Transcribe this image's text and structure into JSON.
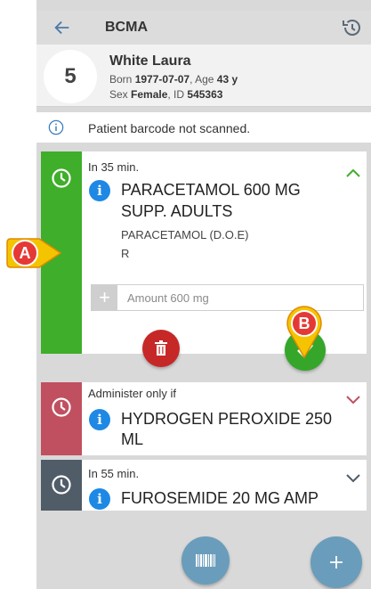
{
  "header": {
    "title": "BCMA"
  },
  "patient": {
    "bed": "5",
    "name": "White Laura",
    "born_label": "Born",
    "born_value": "1977-07-07",
    "age_label": ", Age",
    "age_value": "43 y",
    "sex_label": "Sex",
    "sex_value": "Female",
    "id_label": ", ID",
    "id_value": "545363"
  },
  "notice": {
    "text": "Patient barcode not scanned."
  },
  "cards": [
    {
      "time": "In 35 min.",
      "drug_line1": "PARACETAMOL 600 MG",
      "drug_line2": "SUPP. ADULTS",
      "generic": "PARACETAMOL (D.O.E)",
      "route": "R",
      "amount_placeholder": "Amount 600 mg",
      "strip_color": "#3fae2a"
    },
    {
      "time": "Administer only if",
      "drug_line1": "HYDROGEN PEROXIDE 250",
      "drug_line2": "ML",
      "strip_color": "#c05060"
    },
    {
      "time": "In 55 min.",
      "drug_line1": "FUROSEMIDE 20 MG AMP",
      "strip_color": "#505c68"
    }
  ],
  "markers": {
    "a": "A",
    "b": "B"
  },
  "icons": [
    "back-arrow-icon",
    "history-icon",
    "info-outline-icon",
    "clock-icon",
    "chevron-up-icon",
    "chevron-down-icon",
    "info-icon",
    "plus-icon",
    "trash-icon",
    "check-icon",
    "barcode-icon",
    "add-icon"
  ],
  "colors": {
    "accent_green": "#3fae2a",
    "delete_red": "#c62828",
    "fab_blue": "#6a9dbb",
    "marker_yellow": "#f5c400"
  }
}
